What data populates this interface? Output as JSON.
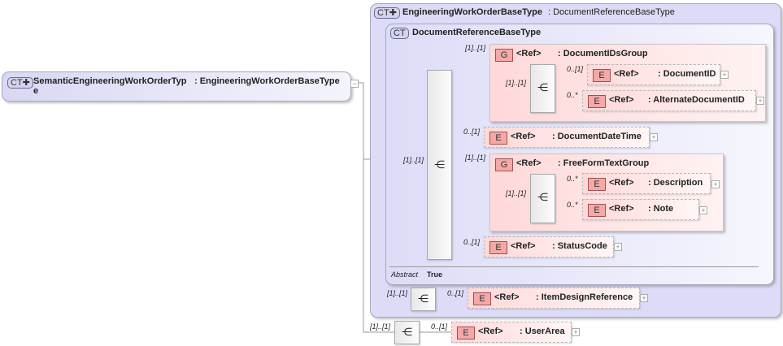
{
  "root": {
    "badge": "CT✚",
    "name_line1": "SemanticEngineeringWorkOrderTyp",
    "name_line2": "e",
    "type": ": EngineeringWorkOrderBaseType",
    "toggle": "−"
  },
  "base": {
    "badge": "CT✚",
    "name": "EngineeringWorkOrderBaseType",
    "type": ": DocumentReferenceBaseType"
  },
  "docref": {
    "badge": "CT",
    "name": "DocumentReferenceBaseType",
    "abstract_label": "Abstract",
    "abstract_value": "True",
    "seq_mult": "[1]..[1]"
  },
  "groups": [
    {
      "icon": "G",
      "ref": "<Ref>",
      "name": ": DocumentIDsGroup",
      "mult": "[1]..[1]",
      "seq_mult": "[1]..[1]",
      "children": [
        {
          "icon": "E",
          "ref": "<Ref>",
          "name": ": DocumentID",
          "mult": "0..[1]"
        },
        {
          "icon": "E",
          "ref": "<Ref>",
          "name": ": AlternateDocumentID",
          "mult": "0..*"
        }
      ]
    },
    {
      "icon": "G",
      "ref": "<Ref>",
      "name": ": FreeFormTextGroup",
      "mult": "[1]..[1]",
      "seq_mult": "[1]..[1]",
      "children": [
        {
          "icon": "E",
          "ref": "<Ref>",
          "name": ": Description",
          "mult": "0..*"
        },
        {
          "icon": "E",
          "ref": "<Ref>",
          "name": ": Note",
          "mult": "0..*"
        }
      ]
    }
  ],
  "elements": [
    {
      "icon": "E",
      "ref": "<Ref>",
      "name": ": DocumentDateTime",
      "mult": "0..[1]"
    },
    {
      "icon": "E",
      "ref": "<Ref>",
      "name": ": StatusCode",
      "mult": "0..[1]"
    },
    {
      "icon": "E",
      "ref": "<Ref>",
      "name": ": ItemDesignReference",
      "mult": "0..[1]",
      "seq_mult": "[1]..[1]"
    },
    {
      "icon": "E",
      "ref": "<Ref>",
      "name": ": UserArea",
      "mult": "0..[1]",
      "seq_mult": "[1]..[1]"
    }
  ],
  "expand_symbol": "+"
}
